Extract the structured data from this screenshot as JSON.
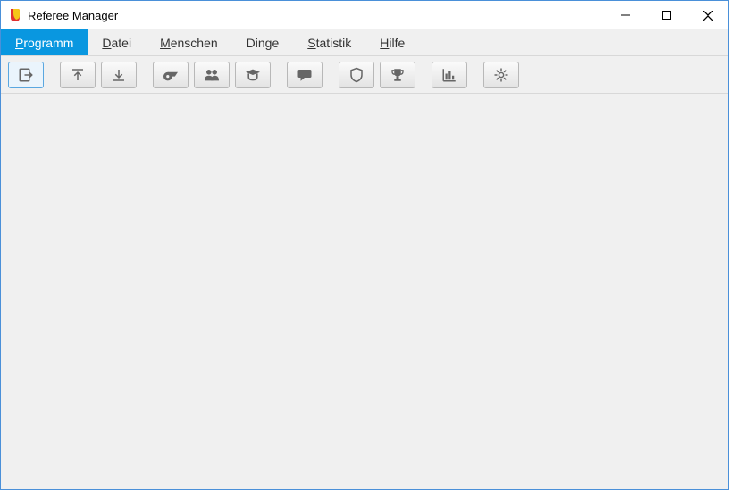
{
  "window": {
    "title": "Referee Manager"
  },
  "menu": {
    "items": [
      {
        "label": "Programm",
        "accel": "P",
        "active": true
      },
      {
        "label": "Datei",
        "accel": "D",
        "active": false
      },
      {
        "label": "Menschen",
        "accel": "M",
        "active": false
      },
      {
        "label": "Dinge",
        "accel": "",
        "active": false
      },
      {
        "label": "Statistik",
        "accel": "S",
        "active": false
      },
      {
        "label": "Hilfe",
        "accel": "H",
        "active": false
      }
    ]
  },
  "toolbar": {
    "groups": [
      [
        {
          "name": "exit-button",
          "icon": "exit",
          "selected": true
        }
      ],
      [
        {
          "name": "upload-button",
          "icon": "upload",
          "selected": false
        },
        {
          "name": "download-button",
          "icon": "download",
          "selected": false
        }
      ],
      [
        {
          "name": "referees-button",
          "icon": "whistle",
          "selected": false
        },
        {
          "name": "people-button",
          "icon": "people",
          "selected": false
        },
        {
          "name": "trainees-button",
          "icon": "graduate",
          "selected": false
        }
      ],
      [
        {
          "name": "messages-button",
          "icon": "message",
          "selected": false
        }
      ],
      [
        {
          "name": "shield-button",
          "icon": "shield",
          "selected": false
        },
        {
          "name": "trophy-button",
          "icon": "trophy",
          "selected": false
        }
      ],
      [
        {
          "name": "statistics-button",
          "icon": "chart",
          "selected": false
        }
      ],
      [
        {
          "name": "settings-button",
          "icon": "gear",
          "selected": false
        }
      ]
    ]
  }
}
